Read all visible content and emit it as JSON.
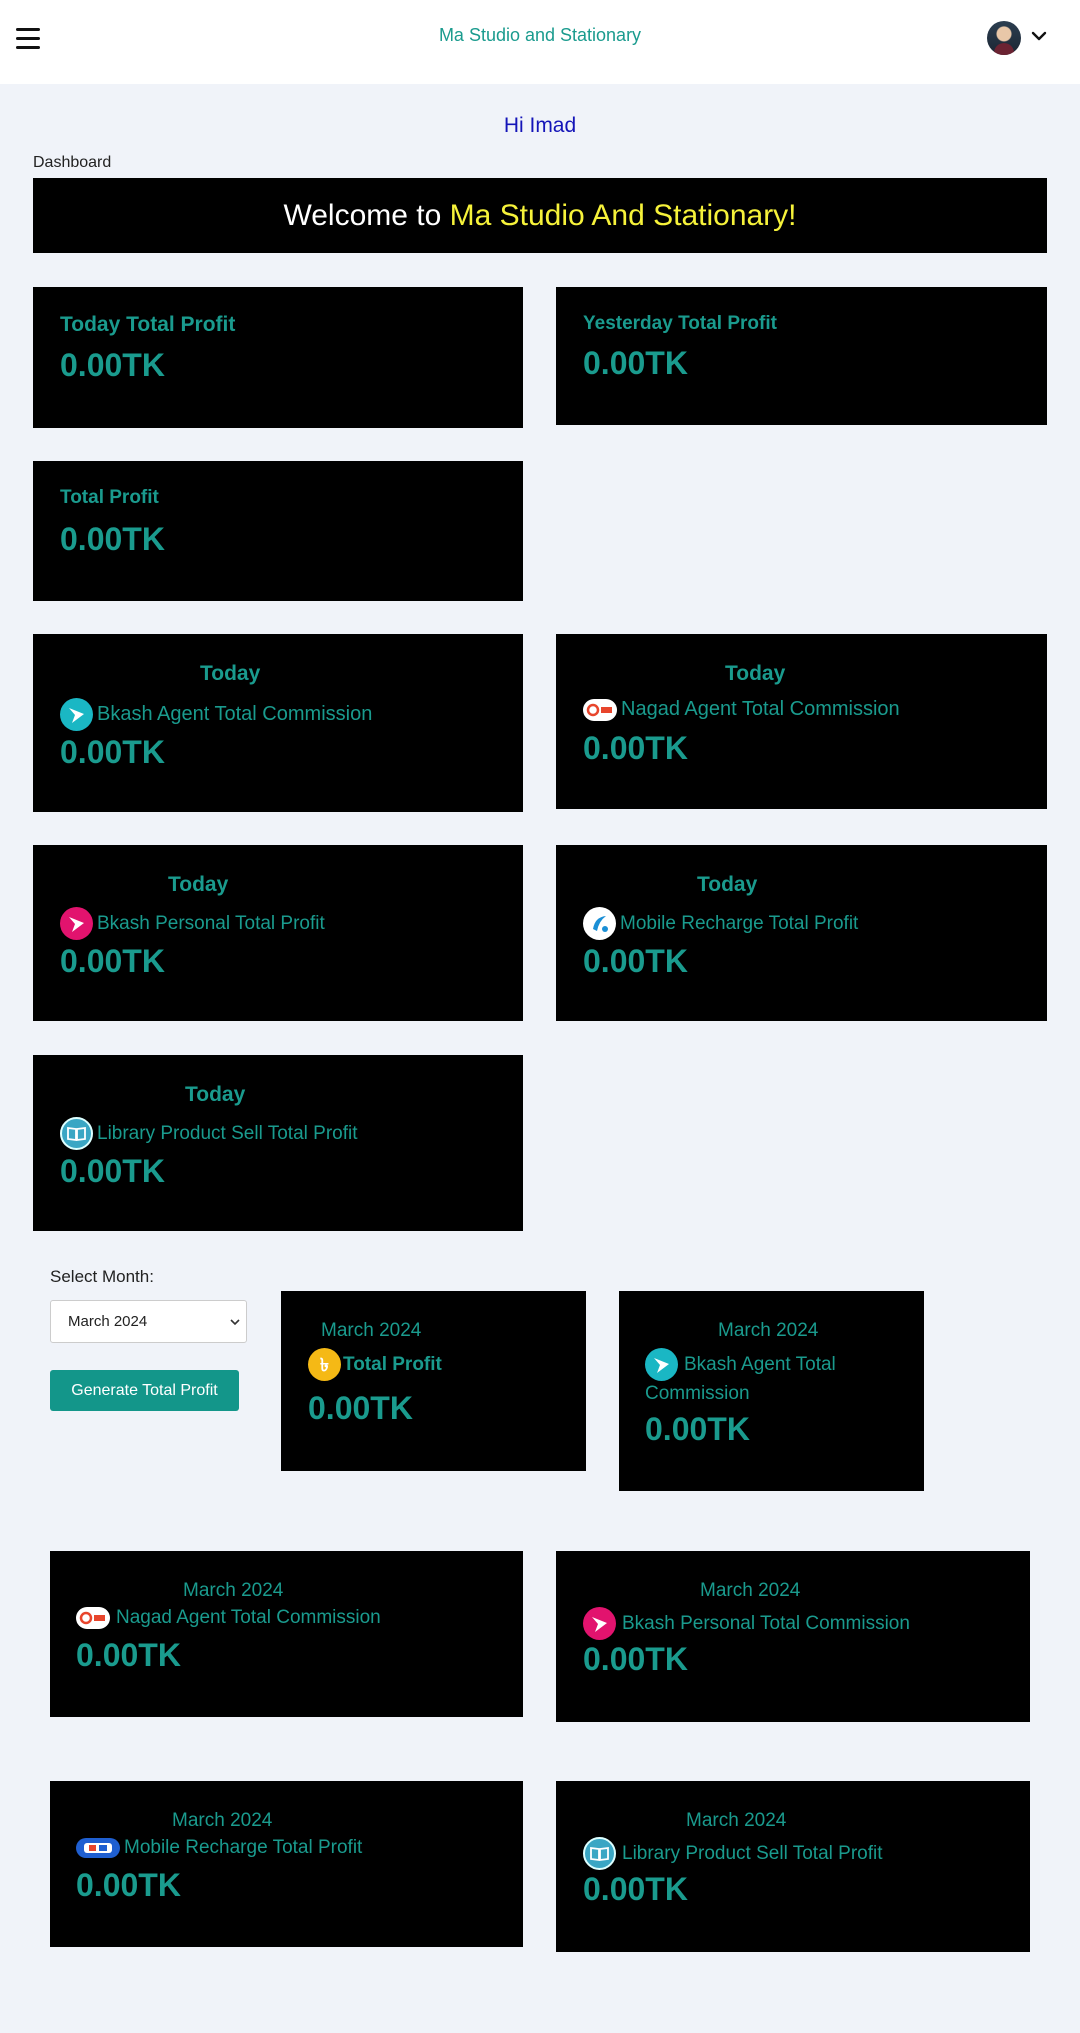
{
  "header": {
    "brand": "Ma Studio and Stationary"
  },
  "greeting": "Hi Imad",
  "breadcrumb": "Dashboard",
  "welcome": {
    "prefix": "Welcome to ",
    "highlight": "Ma Studio And Stationary!"
  },
  "cards": {
    "today_total": {
      "title": "Today Total Profit",
      "value": "0.00TK"
    },
    "yesterday_total": {
      "title": "Yesterday Total Profit",
      "value": "0.00TK"
    },
    "total": {
      "title": "Total Profit",
      "value": "0.00TK"
    },
    "today_bkash_agent": {
      "label": "Today",
      "title": "Bkash Agent Total Commission",
      "value": "0.00TK"
    },
    "today_nagad_agent": {
      "label": "Today",
      "title": "Nagad Agent Total Commission",
      "value": "0.00TK"
    },
    "today_bkash_personal": {
      "label": "Today",
      "title": "Bkash Personal Total Profit",
      "value": "0.00TK"
    },
    "today_mobile_recharge": {
      "label": "Today",
      "title": "Mobile Recharge Total Profit",
      "value": "0.00TK"
    },
    "today_library": {
      "label": "Today",
      "title": "Library Product Sell Total Profit",
      "value": "0.00TK"
    }
  },
  "month_filter": {
    "label": "Select Month:",
    "selected": "March 2024",
    "button": "Generate Total Profit"
  },
  "monthly_cards": {
    "total": {
      "month": "March 2024",
      "title": "Total Profit",
      "value": "0.00TK"
    },
    "bkash_agent": {
      "month": "March 2024",
      "title_line1": "Bkash Agent Total",
      "title_line2": "Commission",
      "value": "0.00TK"
    },
    "nagad_agent": {
      "month": "March 2024",
      "title": "Nagad Agent Total Commission",
      "value": "0.00TK"
    },
    "bkash_personal": {
      "month": "March 2024",
      "title": "Bkash Personal Total Commission",
      "value": "0.00TK"
    },
    "mobile_recharge": {
      "month": "March 2024",
      "title": "Mobile Recharge Total Profit",
      "value": "0.00TK"
    },
    "library": {
      "month": "March 2024",
      "title": "Library Product Sell Total Profit",
      "value": "0.00TK"
    }
  },
  "colors": {
    "accent": "#1a9b8e",
    "highlight": "#f6f23a",
    "greeting": "#1414b8",
    "card_bg": "#000000",
    "page_bg": "#f0f3f9"
  }
}
